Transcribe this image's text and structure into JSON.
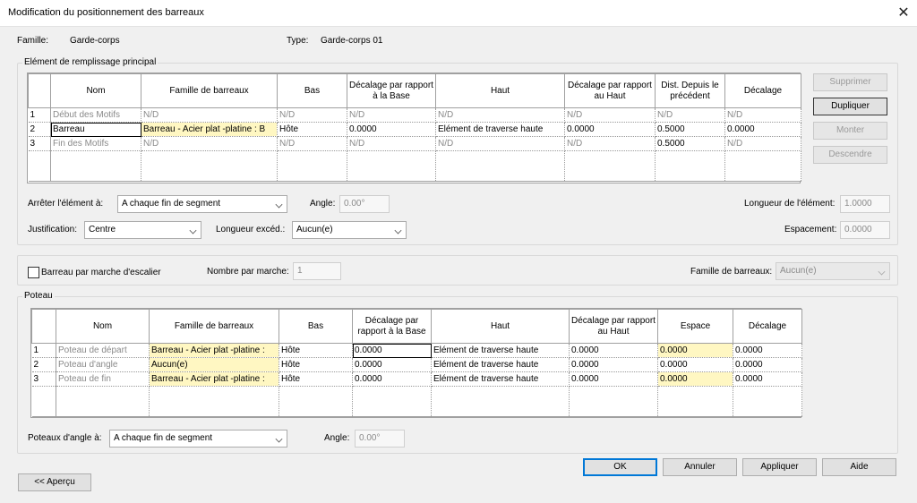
{
  "window": {
    "title": "Modification du positionnement des barreaux",
    "close_icon": "close-icon"
  },
  "header": {
    "famille_label": "Famille:",
    "famille_value": "Garde-corps",
    "type_label": "Type:",
    "type_value": "Garde-corps 01"
  },
  "main_infill": {
    "legend": "Elément de remplissage principal",
    "columns": [
      "Nom",
      "Famille de barreaux",
      "Bas",
      "Décalage par rapport à la Base",
      "Haut",
      "Décalage par rapport au Haut",
      "Dist. Depuis le précédent",
      "Décalage"
    ],
    "rows": [
      {
        "num": "1",
        "cells": [
          "Début des Motifs",
          "N/D",
          "N/D",
          "N/D",
          "N/D",
          "N/D",
          "N/D",
          "N/D"
        ]
      },
      {
        "num": "2",
        "cells": [
          "Barreau",
          "Barreau - Acier plat -platine : B",
          "Hôte",
          "0.0000",
          "Elément de traverse haute",
          "0.0000",
          "0.5000",
          "0.0000"
        ]
      },
      {
        "num": "3",
        "cells": [
          "Fin des Motifs",
          "N/D",
          "N/D",
          "N/D",
          "N/D",
          "N/D",
          "0.5000",
          "N/D"
        ]
      }
    ],
    "buttons": {
      "supprimer": "Supprimer",
      "dupliquer": "Dupliquer",
      "monter": "Monter",
      "descendre": "Descendre"
    },
    "arreter_label": "Arrêter l'élément à:",
    "arreter_value": "A chaque fin de segment",
    "angle_label": "Angle:",
    "angle_value": "0.00°",
    "longueur_element_label": "Longueur de l'élément:",
    "longueur_element_value": "1.0000",
    "justification_label": "Justification:",
    "justification_value": "Centre",
    "longueur_exced_label": "Longueur excéd.:",
    "longueur_exced_value": "Aucun(e)",
    "espacement_label": "Espacement:",
    "espacement_value": "0.0000"
  },
  "stair": {
    "checkbox_label": "Barreau par marche d'escalier",
    "nombre_label": "Nombre par marche:",
    "nombre_value": "1",
    "famille_label": "Famille de barreaux:",
    "famille_value": "Aucun(e)"
  },
  "poteau": {
    "legend": "Poteau",
    "columns": [
      "Nom",
      "Famille de barreaux",
      "Bas",
      "Décalage par rapport à la Base",
      "Haut",
      "Décalage par rapport au Haut",
      "Espace",
      "Décalage"
    ],
    "rows": [
      {
        "num": "1",
        "cells": [
          "Poteau de départ",
          "Barreau - Acier plat -platine :",
          "Hôte",
          "0.0000",
          "Elément de traverse haute",
          "0.0000",
          "0.0000",
          "0.0000"
        ]
      },
      {
        "num": "2",
        "cells": [
          "Poteau d'angle",
          "Aucun(e)",
          "Hôte",
          "0.0000",
          "Elément de traverse haute",
          "0.0000",
          "0.0000",
          "0.0000"
        ]
      },
      {
        "num": "3",
        "cells": [
          "Poteau de fin",
          "Barreau - Acier plat -platine :",
          "Hôte",
          "0.0000",
          "Elément de traverse haute",
          "0.0000",
          "0.0000",
          "0.0000"
        ]
      }
    ],
    "poteaux_angle_label": "Poteaux d'angle à:",
    "poteaux_angle_value": "A chaque fin de segment",
    "angle_label": "Angle:",
    "angle_value": "0.00°"
  },
  "footer": {
    "ok": "OK",
    "annuler": "Annuler",
    "appliquer": "Appliquer",
    "aide": "Aide",
    "apercu": "<< Aperçu"
  }
}
